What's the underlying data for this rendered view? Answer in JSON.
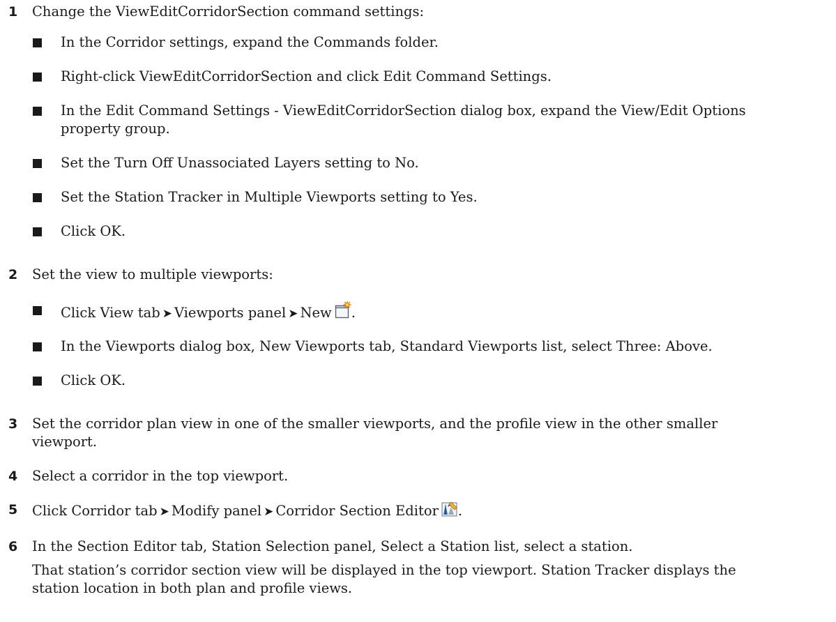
{
  "step1": {
    "num": "1",
    "text": "Change the ViewEditCorridorSection command settings:",
    "bullets": [
      "In the Corridor settings, expand the Commands folder.",
      "Right-click ViewEditCorridorSection and click Edit Command Settings.",
      "In the Edit Command Settings - ViewEditCorridorSection dialog box, expand the View/Edit Options",
      "property group.",
      "Set the Turn Off Unassociated Layers setting to No.",
      "Set the Station Tracker in Multiple Viewports setting to Yes.",
      "Click OK."
    ]
  },
  "step2": {
    "num": "2",
    "text": "Set the view to multiple viewports:",
    "bullet1": {
      "a": "Click View tab",
      "b": "Viewports panel",
      "c": "New",
      "d": "."
    },
    "bullet2": "In the Viewports dialog box, New Viewports tab, Standard Viewports list, select Three: Above.",
    "bullet3": "Click OK."
  },
  "step3": {
    "num": "3",
    "line1": "Set the corridor plan view in one of the smaller viewports, and the profile view in the other smaller",
    "line2": "viewport."
  },
  "step4": {
    "num": "4",
    "text": "Select a corridor in the top viewport."
  },
  "step5": {
    "num": "5",
    "a": "Click Corridor tab",
    "b": "Modify panel",
    "c": "Corridor Section Editor",
    "d": "."
  },
  "step6": {
    "num": "6",
    "text": "In the Section Editor tab, Station Selection panel, Select a Station list, select a station.",
    "note1": "That station’s corridor section view will be displayed in the top viewport. Station Tracker displays the",
    "note2": "station location in both plan and profile views."
  },
  "glyphs": {
    "arrow": "➤"
  },
  "icons": {
    "new_viewport": "new-viewport-icon",
    "section_editor": "corridor-section-editor-icon"
  }
}
